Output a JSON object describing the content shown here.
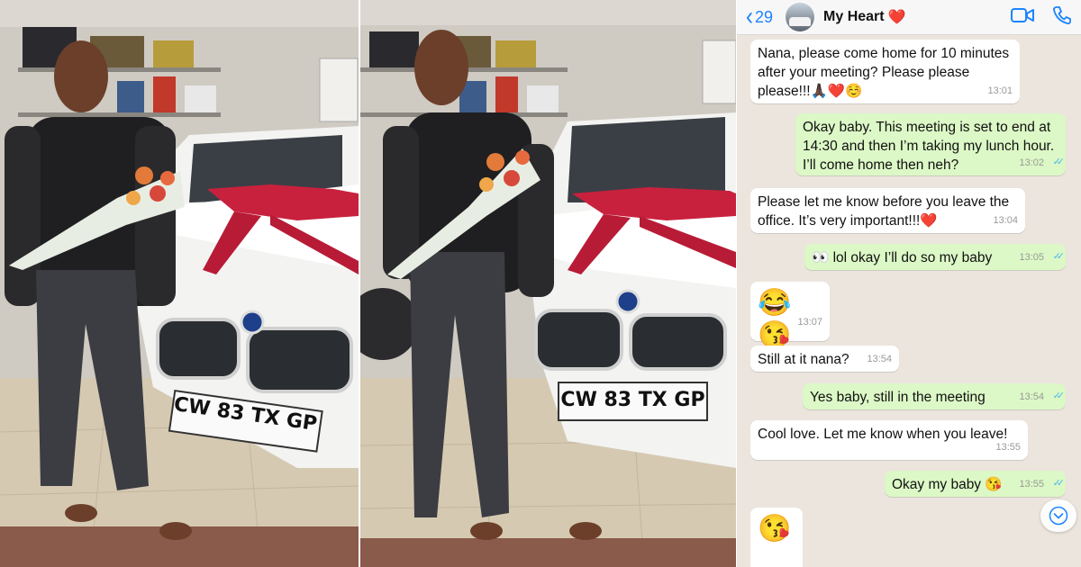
{
  "photos": [
    {
      "plate": "CW 83 TX GP"
    },
    {
      "plate": "CW 83 TX GP"
    }
  ],
  "chat": {
    "back_count": "29",
    "contact_name": "My Heart",
    "contact_emoji": "❤️",
    "icons": {
      "back": "chevron-left-icon",
      "video": "video-camera-icon",
      "call": "phone-icon",
      "scroll": "chevron-down-icon"
    },
    "colors": {
      "incoming": "#ffffff",
      "outgoing": "#dcf8c6",
      "accent": "#1b84ff",
      "read_ticks": "#4fb6ec"
    },
    "messages": [
      {
        "dir": "in",
        "text": "Nana, please come home for 10 minutes after your meeting? Please please please!!!🙏🏿❤️☺️",
        "time": "13:01"
      },
      {
        "dir": "out",
        "text": "Okay baby. This meeting is set to end at 14:30 and then I’m taking my lunch hour. I’ll come home then neh?",
        "time": "13:02",
        "read": true
      },
      {
        "dir": "in",
        "text": "Please let me know before you leave the office. It’s very important!!!❤️",
        "time": "13:04"
      },
      {
        "dir": "out",
        "text": "👀 lol okay I’ll do so my baby",
        "time": "13:05",
        "read": true
      },
      {
        "dir": "in",
        "text": "😂😘",
        "time": "13:07"
      },
      {
        "dir": "in",
        "text": "Still at it nana?",
        "time": "13:54"
      },
      {
        "dir": "out",
        "text": "Yes baby, still in the meeting",
        "time": "13:54",
        "read": true
      },
      {
        "dir": "in",
        "text": "Cool love. Let me know when you leave!",
        "time": "13:55"
      },
      {
        "dir": "out",
        "text": "Okay my baby 😘",
        "time": "13:55",
        "read": true
      },
      {
        "dir": "in",
        "text": "😘",
        "time": ""
      }
    ]
  }
}
